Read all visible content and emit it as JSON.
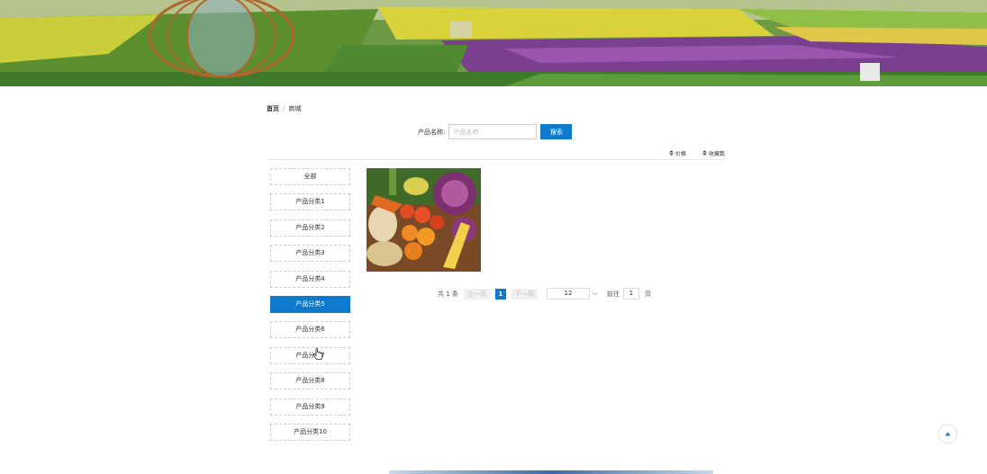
{
  "breadcrumb": {
    "home": "首页",
    "separator": "/",
    "current": "商城"
  },
  "search": {
    "label": "产品名称:",
    "placeholder": "产品名称",
    "button": "搜索"
  },
  "sort": {
    "price": "价格",
    "favorites": "收藏数"
  },
  "categories": [
    {
      "label": "全部"
    },
    {
      "label": "产品分类1"
    },
    {
      "label": "产品分类2"
    },
    {
      "label": "产品分类3"
    },
    {
      "label": "产品分类4"
    },
    {
      "label": "产品分类5",
      "active": true
    },
    {
      "label": "产品分类6"
    },
    {
      "label": "产品分类7"
    },
    {
      "label": "产品分类8"
    },
    {
      "label": "产品分类9"
    },
    {
      "label": "产品分类10"
    }
  ],
  "pagination": {
    "total": "共 1 条",
    "prev": "上一页",
    "current": "1",
    "next": "下一页",
    "page_size": "12",
    "goto_label": "前往",
    "goto_value": "1",
    "goto_unit": "页"
  },
  "icons": {
    "sort_price": "sort-icon",
    "sort_favorites": "sort-icon",
    "page_size_dropdown": "chevron-down-icon",
    "back_to_top": "arrow-up-icon",
    "cursor": "hand-cursor-icon"
  },
  "colors": {
    "accent": "#0f7acb"
  }
}
